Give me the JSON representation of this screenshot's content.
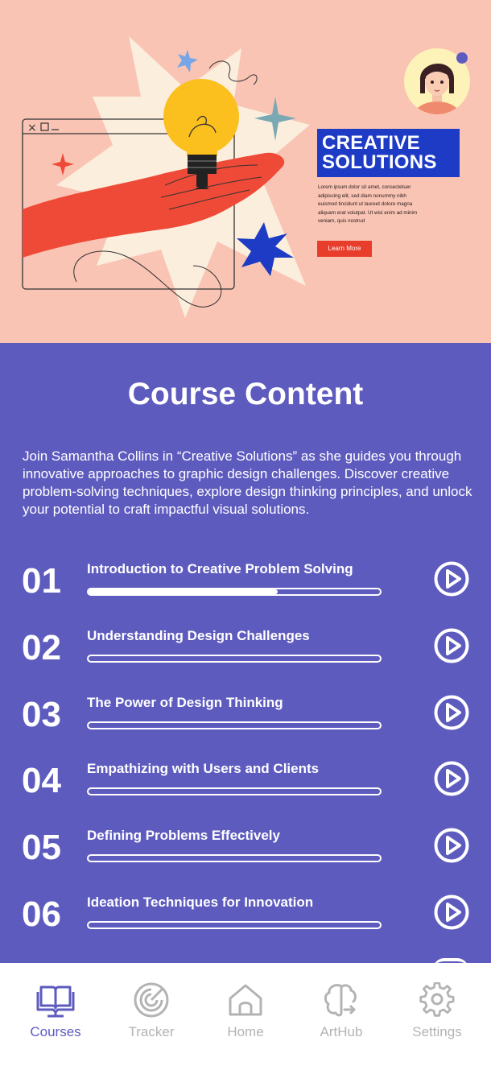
{
  "hero": {
    "headline_line1": "CREATIVE",
    "headline_line2": "SOLUTIONS",
    "lorem": "Lorem ipsum dolor sit amet, consectetuer adipiscing elit, sed diam nonummy nibh euismod tincidunt ut laoreet dolore magna aliquam erat volutpat. Ut wisi enim ad minim veniam, quis nostrud",
    "learn_more": "Learn More"
  },
  "content": {
    "title": "Course Content",
    "intro": "Join Samantha Collins in “Creative Solutions” as she guides you through innovative approaches to graphic design challenges. Discover creative problem-solving techniques, explore design thinking principles, and unlock your potential to craft impactful visual solutions."
  },
  "lessons": [
    {
      "num": "01",
      "title": "Introduction to Creative Problem Solving",
      "progress": 0.65
    },
    {
      "num": "02",
      "title": "Understanding Design Challenges",
      "progress": 0
    },
    {
      "num": "03",
      "title": "The Power of Design Thinking",
      "progress": 0
    },
    {
      "num": "04",
      "title": "Empathizing with Users and Clients",
      "progress": 0
    },
    {
      "num": "05",
      "title": "Defining Problems Effectively",
      "progress": 0
    },
    {
      "num": "06",
      "title": "Ideation Techniques for Innovation",
      "progress": 0
    }
  ],
  "nav": {
    "items": [
      {
        "label": "Courses",
        "icon": "book-icon",
        "active": true
      },
      {
        "label": "Tracker",
        "icon": "target-icon",
        "active": false
      },
      {
        "label": "Home",
        "icon": "home-icon",
        "active": false
      },
      {
        "label": "ArtHub",
        "icon": "brain-icon",
        "active": false
      },
      {
        "label": "Settings",
        "icon": "gear-icon",
        "active": false
      }
    ]
  },
  "colors": {
    "accent": "#5e5bbf",
    "hero_bg": "#f9c4b4",
    "headline_bg": "#1d3bc4",
    "button_red": "#e83d2a",
    "inactive": "#b3b3b3"
  }
}
